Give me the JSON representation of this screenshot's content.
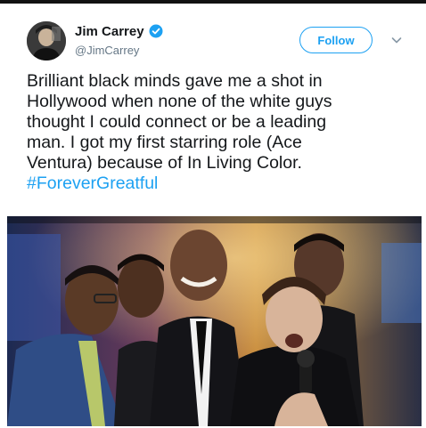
{
  "tweet": {
    "display_name": "Jim Carrey",
    "handle": "@JimCarrey",
    "follow_label": "Follow",
    "text_lines": [
      "Brilliant black minds gave me a shot in",
      "Hollywood when none of the white guys",
      "thought I could connect or be a leading",
      "man. I got my first starring role (Ace",
      "Ventura) because of In Living Color."
    ],
    "hashtag": "#ForeverGreatful"
  },
  "colors": {
    "link_blue": "#1da1f2",
    "text_dark": "#14171a",
    "handle_gray": "#657786"
  },
  "icons": {
    "verified": "verified-badge-icon",
    "menu": "chevron-down-icon"
  }
}
